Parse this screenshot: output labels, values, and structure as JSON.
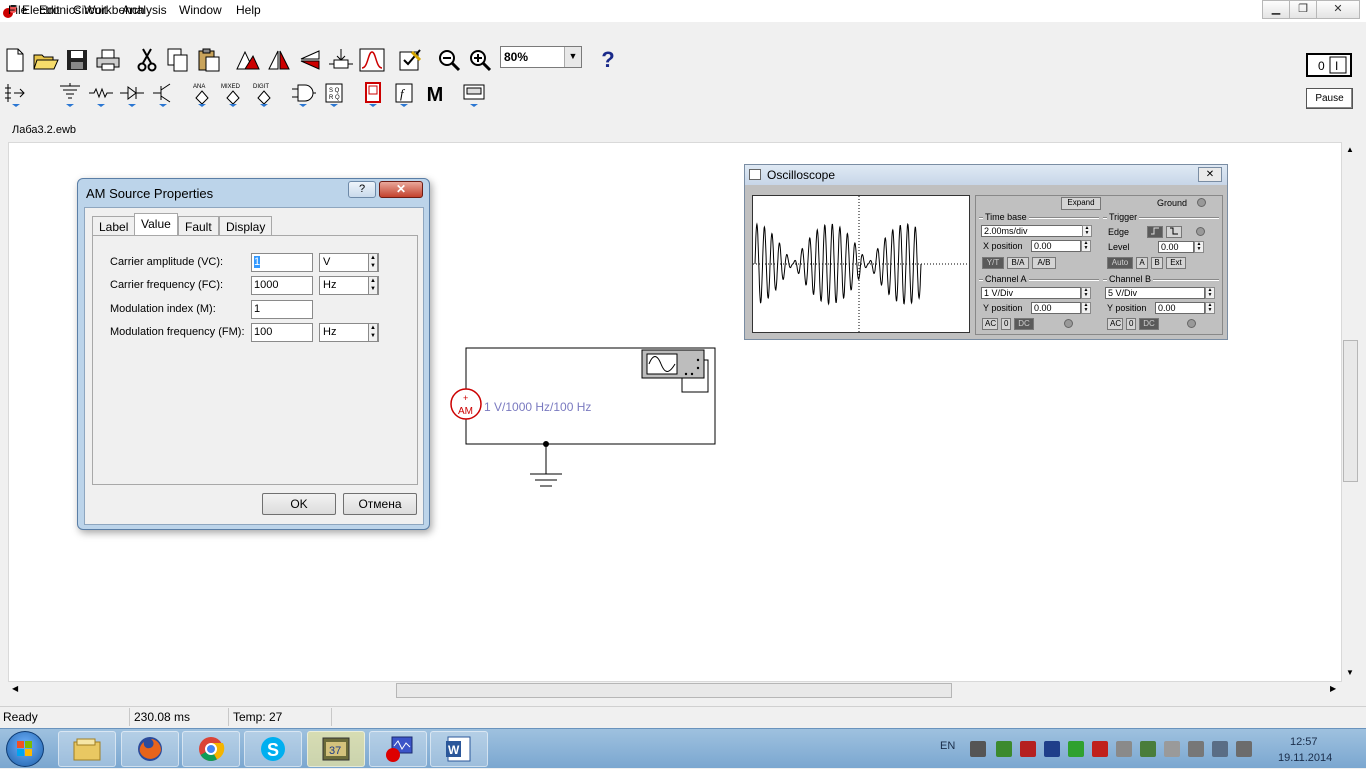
{
  "window": {
    "title": "Electronics Workbench",
    "minimize": "▁",
    "maximize": "❐",
    "close": "✕"
  },
  "menu": [
    "File",
    "Edit",
    "Circuit",
    "Analysis",
    "Window",
    "Help"
  ],
  "toolbar": {
    "zoom": "80%",
    "help": "?",
    "pause": "Pause",
    "icons": [
      "new-icon",
      "open-icon",
      "save-icon",
      "print-icon",
      "cut-icon",
      "copy-icon",
      "paste-icon",
      "rotate-icon",
      "flip-horizontal-icon",
      "flip-vertical-icon",
      "subcircuit-icon",
      "graph-icon",
      "component-properties-icon",
      "zoom-out-icon",
      "zoom-in-icon"
    ]
  },
  "parts_toolbar": {
    "labels": {
      "analog": "ANA",
      "mixed": "MIXED",
      "digital": "DIGIT",
      "misc": "M"
    }
  },
  "document": {
    "name": "Лаба3.2.ewb"
  },
  "circuit": {
    "source_symbol": "AM",
    "source_plus": "+",
    "source_label": "1 V/1000 Hz/100 Hz"
  },
  "dialog": {
    "title": "AM Source Properties",
    "help": "?",
    "close": "✕",
    "tabs": [
      "Label",
      "Value",
      "Fault",
      "Display"
    ],
    "active_tab": "Value",
    "fields": [
      {
        "label": "Carrier amplitude (VC):",
        "value": "1",
        "unit": "V"
      },
      {
        "label": "Carrier frequency (FC):",
        "value": "1000",
        "unit": "Hz"
      },
      {
        "label": "Modulation index (M):",
        "value": "1",
        "unit": ""
      },
      {
        "label": "Modulation frequency (FM):",
        "value": "100",
        "unit": "Hz"
      }
    ],
    "ok": "OK",
    "cancel": "Отмена"
  },
  "oscilloscope": {
    "title": "Oscilloscope",
    "close": "✕",
    "expand": "Expand",
    "ground": "Ground",
    "time_base": {
      "label": "Time base",
      "value": "2.00ms/div",
      "x_position_label": "X position",
      "x_position": "0.00",
      "modes": [
        "Y/T",
        "B/A",
        "A/B"
      ]
    },
    "trigger": {
      "label": "Trigger",
      "edge": "Edge",
      "level_label": "Level",
      "level": "0.00",
      "sources": [
        "Auto",
        "A",
        "B",
        "Ext"
      ]
    },
    "channel_a": {
      "label": "Channel A",
      "value": "1  V/Div",
      "y_position_label": "Y position",
      "y_position": "0.00",
      "coupling": [
        "AC",
        "0",
        "DC"
      ]
    },
    "channel_b": {
      "label": "Channel B",
      "value": "5  V/Div",
      "y_position_label": "Y position",
      "y_position": "0.00",
      "coupling": [
        "AC",
        "0",
        "DC"
      ]
    }
  },
  "status": {
    "state": "Ready",
    "time": "230.08 ms",
    "temp": "Temp:  27"
  },
  "taskbar": {
    "apps": [
      "file-explorer-icon",
      "firefox-icon",
      "chrome-icon",
      "skype-icon",
      "media-player-icon",
      "electronics-workbench-icon",
      "word-icon"
    ],
    "lang": "EN",
    "time": "12:57",
    "date": "19.11.2014"
  }
}
